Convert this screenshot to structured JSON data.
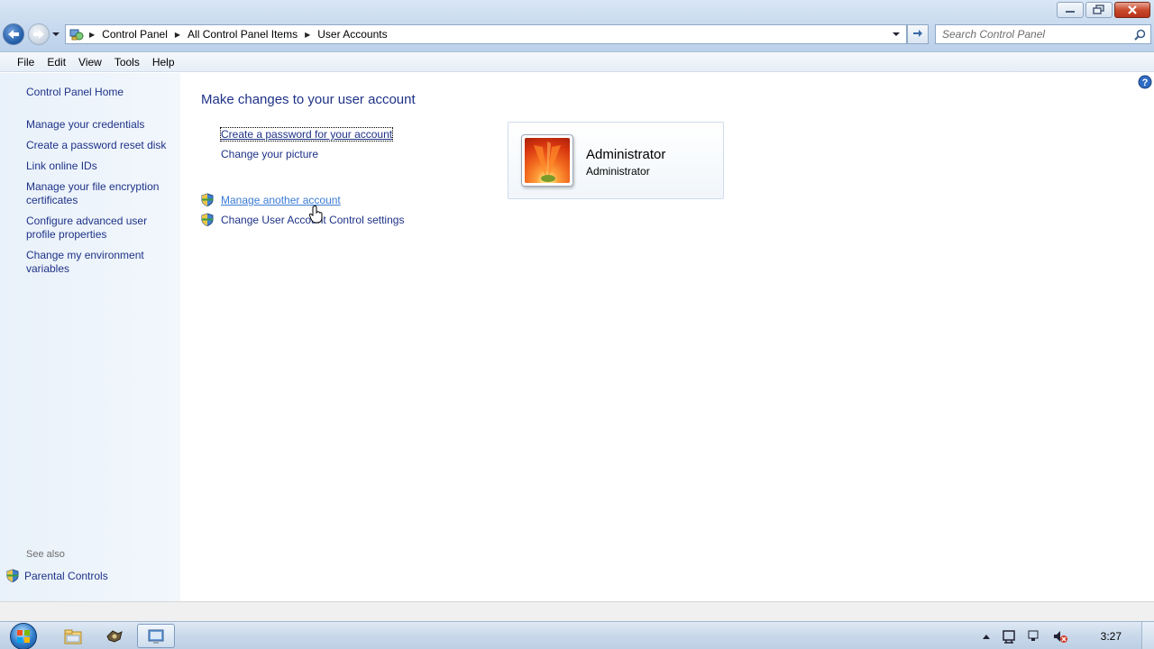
{
  "window": {
    "controls": [
      "minimize",
      "restore",
      "close"
    ]
  },
  "address_bar": {
    "crumbs": [
      "Control Panel",
      "All Control Panel Items",
      "User Accounts"
    ]
  },
  "search": {
    "placeholder": "Search Control Panel"
  },
  "menu": {
    "file": "File",
    "edit": "Edit",
    "view": "View",
    "tools": "Tools",
    "help": "Help"
  },
  "sidebar": {
    "home": "Control Panel Home",
    "items": [
      "Manage your credentials",
      "Create a password reset disk",
      "Link online IDs",
      "Manage your file encryption certificates",
      "Configure advanced user profile properties",
      "Change my environment variables"
    ],
    "see_also": "See also",
    "parental_controls": "Parental Controls"
  },
  "main": {
    "heading": "Make changes to your user account",
    "links": {
      "create_password": "Create a password for your account",
      "change_picture": "Change your picture",
      "manage_another": "Manage another account",
      "uac_settings": "Change User Account Control settings"
    },
    "account": {
      "name": "Administrator",
      "type": "Administrator"
    }
  },
  "taskbar": {
    "clock": "3:27"
  },
  "colors": {
    "link": "#1e3287",
    "link_hover": "#3a7bd5",
    "sidebar_bg": "#e9f1fa"
  }
}
